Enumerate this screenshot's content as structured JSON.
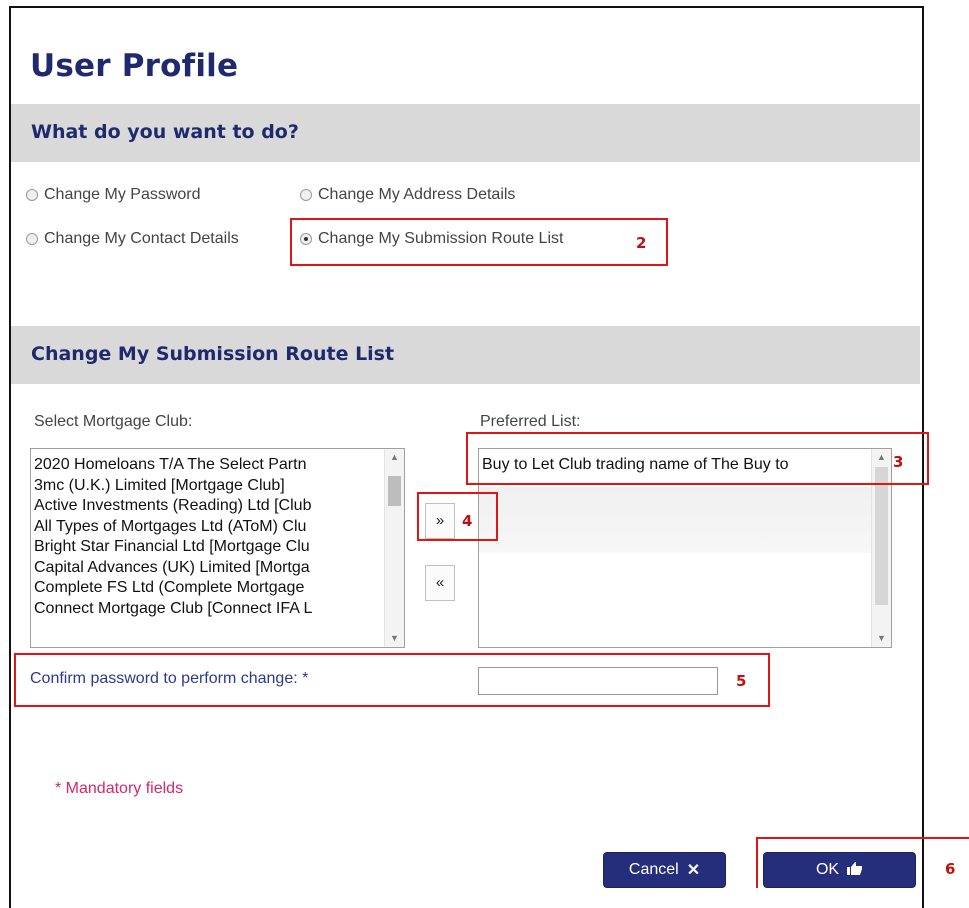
{
  "page": {
    "title": "User Profile"
  },
  "actions": {
    "heading": "What do you want to do?",
    "options": [
      {
        "label": "Change My Password",
        "selected": false
      },
      {
        "label": "Change My Address Details",
        "selected": false
      },
      {
        "label": "Change My Contact Details",
        "selected": false
      },
      {
        "label": "Change My Submission Route List",
        "selected": true
      }
    ]
  },
  "route_list": {
    "heading": "Change My Submission Route List",
    "clubs_label": "Select Mortgage Club:",
    "clubs": [
      "2020 Homeloans T/A The Select Partn",
      "3mc (U.K.) Limited [Mortgage Club]",
      "Active Investments (Reading) Ltd [Club",
      "All Types of Mortgages Ltd (AToM) Clu",
      "Bright Star Financial Ltd [Mortgage Clu",
      "Capital Advances (UK) Limited [Mortga",
      "Complete FS Ltd (Complete Mortgage",
      "Connect Mortgage Club [Connect IFA L"
    ],
    "preferred_label": "Preferred List:",
    "preferred": [
      "Buy to Let Club trading name of The Buy to"
    ],
    "add_label": "»",
    "remove_label": "«"
  },
  "password": {
    "label": "Confirm password to perform change: *",
    "value": ""
  },
  "mandatory_note": "* Mandatory fields",
  "buttons": {
    "cancel": "Cancel",
    "ok": "OK"
  },
  "annotations": [
    "2",
    "3",
    "4",
    "5",
    "6"
  ],
  "colors": {
    "heading": "#1f2a6e",
    "band": "#d9d9d9",
    "button": "#252e7a",
    "mandatory": "#d6256e",
    "highlight": "#e01616"
  }
}
